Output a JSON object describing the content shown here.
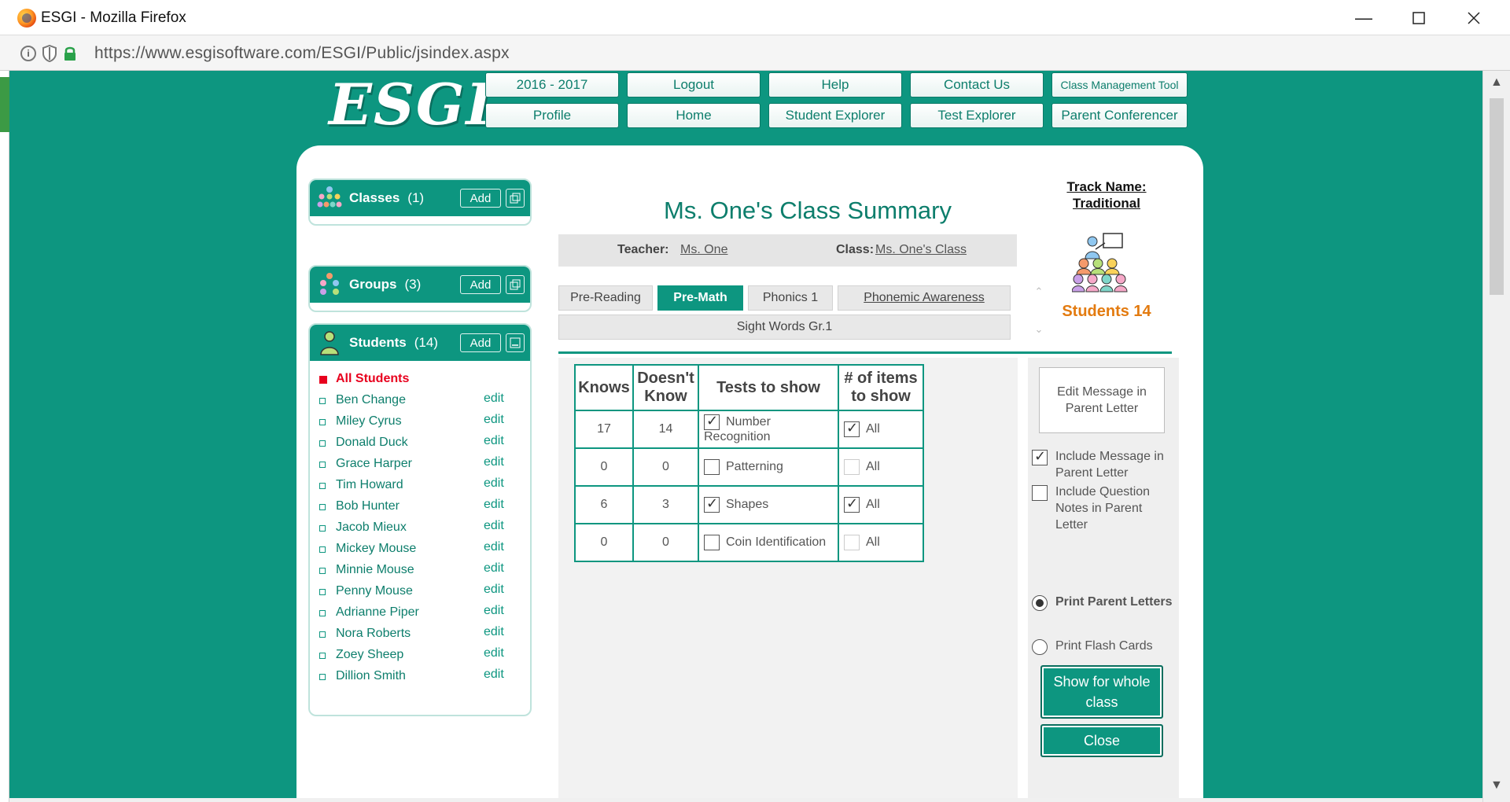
{
  "window": {
    "title": "ESGI - Mozilla Firefox",
    "url": "https://www.esgisoftware.com/ESGI/Public/jsindex.aspx"
  },
  "logo": {
    "text": "ESGI"
  },
  "nav": {
    "row1": [
      "2016 - 2017",
      "Logout",
      "Help",
      "Contact Us",
      "Class Management Tool"
    ],
    "row2": [
      "Profile",
      "Home",
      "Student Explorer",
      "Test Explorer",
      "Parent Conferencer"
    ]
  },
  "sidebar": {
    "classes": {
      "title": "Classes",
      "count": "(1)",
      "add": "Add"
    },
    "groups": {
      "title": "Groups",
      "count": "(3)",
      "add": "Add"
    },
    "students": {
      "title": "Students",
      "count": "(14)",
      "add": "Add",
      "all_label": "All Students",
      "edit_label": "edit",
      "items": [
        "Ben Change",
        "Miley Cyrus",
        "Donald Duck",
        "Grace Harper",
        "Tim Howard",
        "Bob Hunter",
        "Jacob Mieux",
        "Mickey Mouse",
        "Minnie Mouse",
        "Penny Mouse",
        "Adrianne Piper",
        "Nora Roberts",
        "Zoey Sheep",
        "Dillion Smith"
      ]
    }
  },
  "summary": {
    "title": "Ms. One's Class Summary",
    "teacher_label": "Teacher:",
    "teacher": "Ms. One",
    "class_label": "Class:",
    "class_name": "Ms. One's Class"
  },
  "tabs": [
    "Pre-Reading",
    "Pre-Math",
    "Phonics 1",
    "Phonemic Awareness",
    "Sight Words Gr.1"
  ],
  "active_tab": "Pre-Math",
  "table": {
    "headers": {
      "knows": "Knows",
      "doesnt_know_1": "Doesn't",
      "doesnt_know_2": "Know",
      "tests": "Tests to show",
      "items_1": "# of items",
      "items_2": "to show"
    },
    "rows": [
      {
        "knows": "17",
        "doesnt_know": "14",
        "test": "Number Recognition",
        "checked": true,
        "items": "All",
        "items_checked": true
      },
      {
        "knows": "0",
        "doesnt_know": "0",
        "test": "Patterning",
        "checked": false,
        "items": "All",
        "items_checked": false
      },
      {
        "knows": "6",
        "doesnt_know": "3",
        "test": "Shapes",
        "checked": true,
        "items": "All",
        "items_checked": true
      },
      {
        "knows": "0",
        "doesnt_know": "0",
        "test": "Coin Identification",
        "checked": false,
        "items": "All",
        "items_checked": false
      }
    ]
  },
  "right": {
    "track_label": "Track Name:",
    "track_name": "Traditional",
    "students_label": "Students 14",
    "edit_message": "Edit Message in Parent Letter",
    "include_message": "Include Message in Parent Letter",
    "include_notes": "Include Question Notes in Parent Letter",
    "print_letters": "Print Parent Letters",
    "print_cards": "Print Flash Cards",
    "show_whole_class": "Show for whole class",
    "close": "Close"
  }
}
